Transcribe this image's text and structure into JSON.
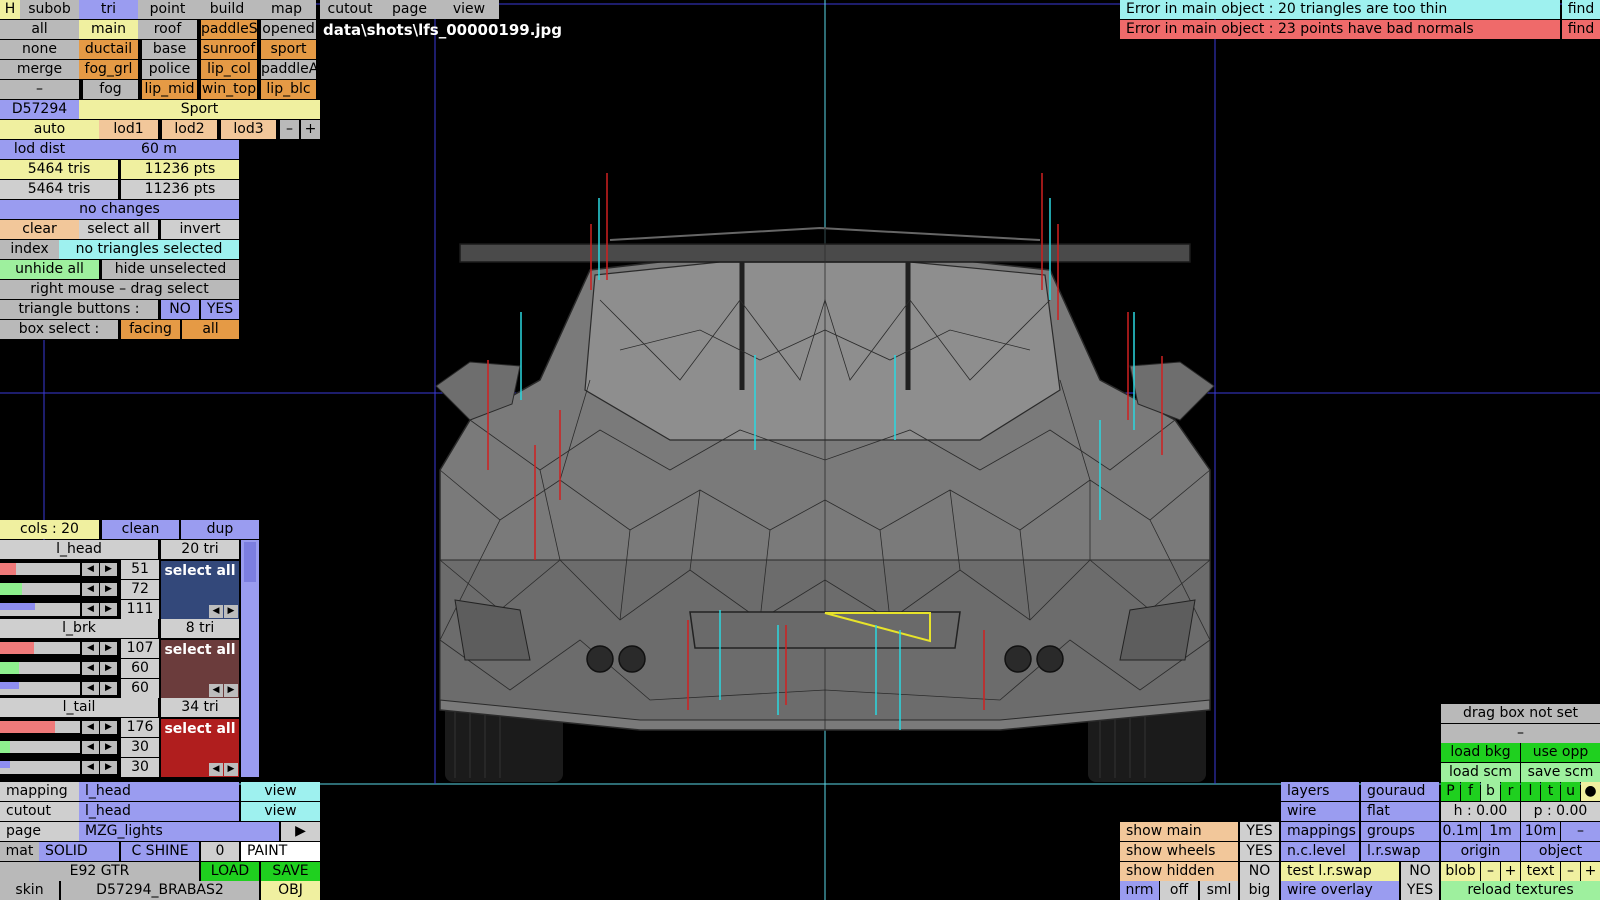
{
  "top_menu": {
    "h": "H",
    "items": [
      "subob",
      "tri",
      "point",
      "build",
      "map",
      "cutout",
      "page",
      "view"
    ]
  },
  "row1": [
    "all",
    "main",
    "roof",
    "paddleS",
    "opened"
  ],
  "row2": [
    "none",
    "ductail",
    "base",
    "sunroof",
    "sport"
  ],
  "row3": [
    "merge",
    "fog_grl",
    "police",
    "lip_col",
    "paddleA"
  ],
  "row4": [
    "–",
    "fog",
    "lip_mid",
    "win_top",
    "lip_blc"
  ],
  "car_id": "D57294",
  "car_class": "Sport",
  "lod": {
    "auto": "auto",
    "items": [
      "lod1",
      "lod2",
      "lod3"
    ],
    "minus": "–",
    "plus": "+"
  },
  "lod_dist": {
    "label": "lod dist",
    "value": "60 m"
  },
  "stats": [
    {
      "tris": "5464 tris",
      "pts": "11236 pts"
    },
    {
      "tris": "5464 tris",
      "pts": "11236 pts"
    }
  ],
  "changes": "no changes",
  "sel": {
    "clear": "clear",
    "select_all": "select all",
    "invert": "invert"
  },
  "index": {
    "label": "index",
    "value": "no triangles selected"
  },
  "hide": {
    "unhide": "unhide all",
    "hide": "hide unselected"
  },
  "rmouse": "right mouse – drag select",
  "tri_buttons": {
    "label": "triangle buttons :",
    "no": "NO",
    "yes": "YES"
  },
  "box_select": {
    "label": "box select :",
    "facing": "facing",
    "all": "all"
  },
  "filename": "data\\shots\\lfs_00000199.jpg",
  "errors": [
    {
      "text": "Error in main object : 20 triangles are too thin",
      "find": "find"
    },
    {
      "text": "Error in main object : 23 points have bad normals",
      "find": "find"
    }
  ],
  "colors_panel": {
    "header": {
      "cols": "cols : 20",
      "clean": "clean",
      "dup": "dup"
    },
    "groups": [
      {
        "name": "l_head",
        "tri": "20 tri",
        "r": "51",
        "g": "72",
        "b": "111",
        "rv": 0.2,
        "gv": 0.28,
        "bv": 0.44,
        "btn": "select all",
        "color": "#33487a"
      },
      {
        "name": "l_brk",
        "tri": "8 tri",
        "r": "107",
        "g": "60",
        "b": "60",
        "rv": 0.42,
        "gv": 0.24,
        "bv": 0.24,
        "btn": "select all",
        "color": "#6b3c3c"
      },
      {
        "name": "l_tail",
        "tri": "34 tri",
        "r": "176",
        "g": "30",
        "b": "30",
        "rv": 0.69,
        "gv": 0.12,
        "bv": 0.12,
        "btn": "select all",
        "color": "#b01e1e"
      }
    ]
  },
  "bottom_left": {
    "mapping": {
      "label": "mapping",
      "value": "l_head",
      "view": "view"
    },
    "cutout": {
      "label": "cutout",
      "value": "l_head",
      "view": "view"
    },
    "page": {
      "label": "page",
      "value": "MZG_lights",
      "arrow": "▶"
    },
    "mat": {
      "label": "mat",
      "solid": "SOLID",
      "shine": "C SHINE",
      "num": "0",
      "paint": "PAINT"
    },
    "model": {
      "name": "E92 GTR",
      "load": "LOAD",
      "save": "SAVE"
    },
    "skin": {
      "label": "skin",
      "value": "D57294_BRABAS2",
      "obj": "OBJ"
    }
  },
  "bottom_mid": [
    {
      "label": "show main",
      "value": "YES"
    },
    {
      "label": "show wheels",
      "value": "YES"
    },
    {
      "label": "show hidden",
      "value": "NO"
    }
  ],
  "nrm_row": [
    "nrm",
    "off",
    "sml",
    "big"
  ],
  "render": {
    "layers": "layers",
    "gouraud": "gouraud",
    "wire": "wire",
    "flat": "flat",
    "mappings": "mappings",
    "groups": "groups",
    "nclevel": "n.c.level",
    "lrswap": "l.r.swap",
    "test": "test l.r.swap",
    "test_val": "NO",
    "overlay": "wire overlay",
    "overlay_val": "YES"
  },
  "right_panel": {
    "drag": "drag box not set",
    "dash": "–",
    "load_bkg": "load bkg",
    "use_opp": "use opp",
    "load_scm": "load scm",
    "save_scm": "save scm",
    "views": [
      "P",
      "f",
      "b",
      "r",
      "l",
      "t",
      "u",
      "●"
    ],
    "h": "h : 0.00",
    "p": "p : 0.00",
    "steps": [
      "0.1m",
      "1m",
      "10m",
      "–"
    ],
    "origin": "origin",
    "object": "object",
    "blob": "blob",
    "text": "text",
    "minus": "–",
    "plus": "+",
    "reload": "reload textures"
  }
}
